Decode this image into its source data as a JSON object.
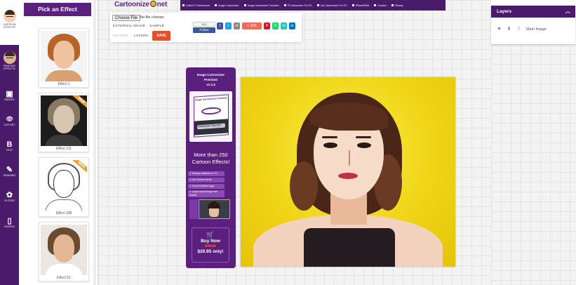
{
  "rail": {
    "items": [
      {
        "label": "CARTOON EFFECTS",
        "glyph": ""
      },
      {
        "label": "PAINTING EFFECTS",
        "glyph": ""
      },
      {
        "label": "IMAGES",
        "glyph": "▣"
      },
      {
        "label": "CLIP ART",
        "glyph": "👁"
      },
      {
        "label": "TEXT",
        "glyph": "B"
      },
      {
        "label": "DRAWING",
        "glyph": "✎"
      },
      {
        "label": "FILTERS",
        "glyph": "✿"
      },
      {
        "label": "SHAPES",
        "glyph": "▯"
      }
    ]
  },
  "effects": {
    "title": "Pick an Effect",
    "items": [
      {
        "caption": "Effect 1",
        "badge": ""
      },
      {
        "caption": "Effect 211",
        "badge": "NEW"
      },
      {
        "caption": "Effect 208",
        "badge": "NEW"
      },
      {
        "caption": "Effect 51",
        "badge": ""
      }
    ]
  },
  "logo": {
    "pre": "Cartoonize",
    "post": "net"
  },
  "topnav": {
    "items": [
      "Online Pl Cartoonizer",
      "Image Cartoonizer",
      "Image Cartoonizer Premium",
      "Pl Cartoonizer For PC",
      "Our Cartoonizer For PC",
      "iPhone/iPad",
      "Contact",
      "Privacy"
    ]
  },
  "toolbar": {
    "choose_file": "Choose File",
    "no_file": "No file chosen",
    "external_image": "EXTERNAL IMAGE",
    "sample": "SAMPLE",
    "eraser": "ERASER",
    "layers": "LAYERS",
    "save": "SAVE",
    "like_count": "78 K",
    "like": "Follow"
  },
  "share_buttons": [
    {
      "name": "facebook",
      "color": "#3b5998",
      "label": "f"
    },
    {
      "name": "twitter",
      "color": "#1da1f2",
      "label": "t"
    },
    {
      "name": "email",
      "color": "#888888",
      "label": "✉"
    },
    {
      "name": "share-count",
      "color": "#f06a5a",
      "label": "+ 31K"
    },
    {
      "name": "pinterest",
      "color": "#cb2027",
      "label": "P"
    },
    {
      "name": "whatsapp",
      "color": "#25d366",
      "label": "✆"
    },
    {
      "name": "sms",
      "color": "#2ec4b6",
      "label": "✉"
    },
    {
      "name": "linkedin",
      "color": "#0077b5",
      "label": "in"
    }
  ],
  "promo": {
    "title_1": "Image Cartoonizer",
    "title_2": "Premium",
    "version": "v1.1.5",
    "box_top": "Image Cartoonizer Premium",
    "box_mid": "Cartoonize Yourself",
    "headline": "More than 250 Cartoon Effects!",
    "features": [
      "✔ Desktop software for PC",
      "✔ One license for life",
      "✔ Convert without login",
      "✔ Large output image size feature"
    ],
    "buy_now": "Buy Now",
    "old_price": "$49.95",
    "price": "$29.95 only!"
  },
  "layers": {
    "title": "Layers",
    "row_label": "Main Image"
  },
  "colors": {
    "brand_purple": "#4a1a6b",
    "accent_purple": "#5b1f7e",
    "save_orange": "#e8502c",
    "canvas_yellow": "#f0d416"
  }
}
